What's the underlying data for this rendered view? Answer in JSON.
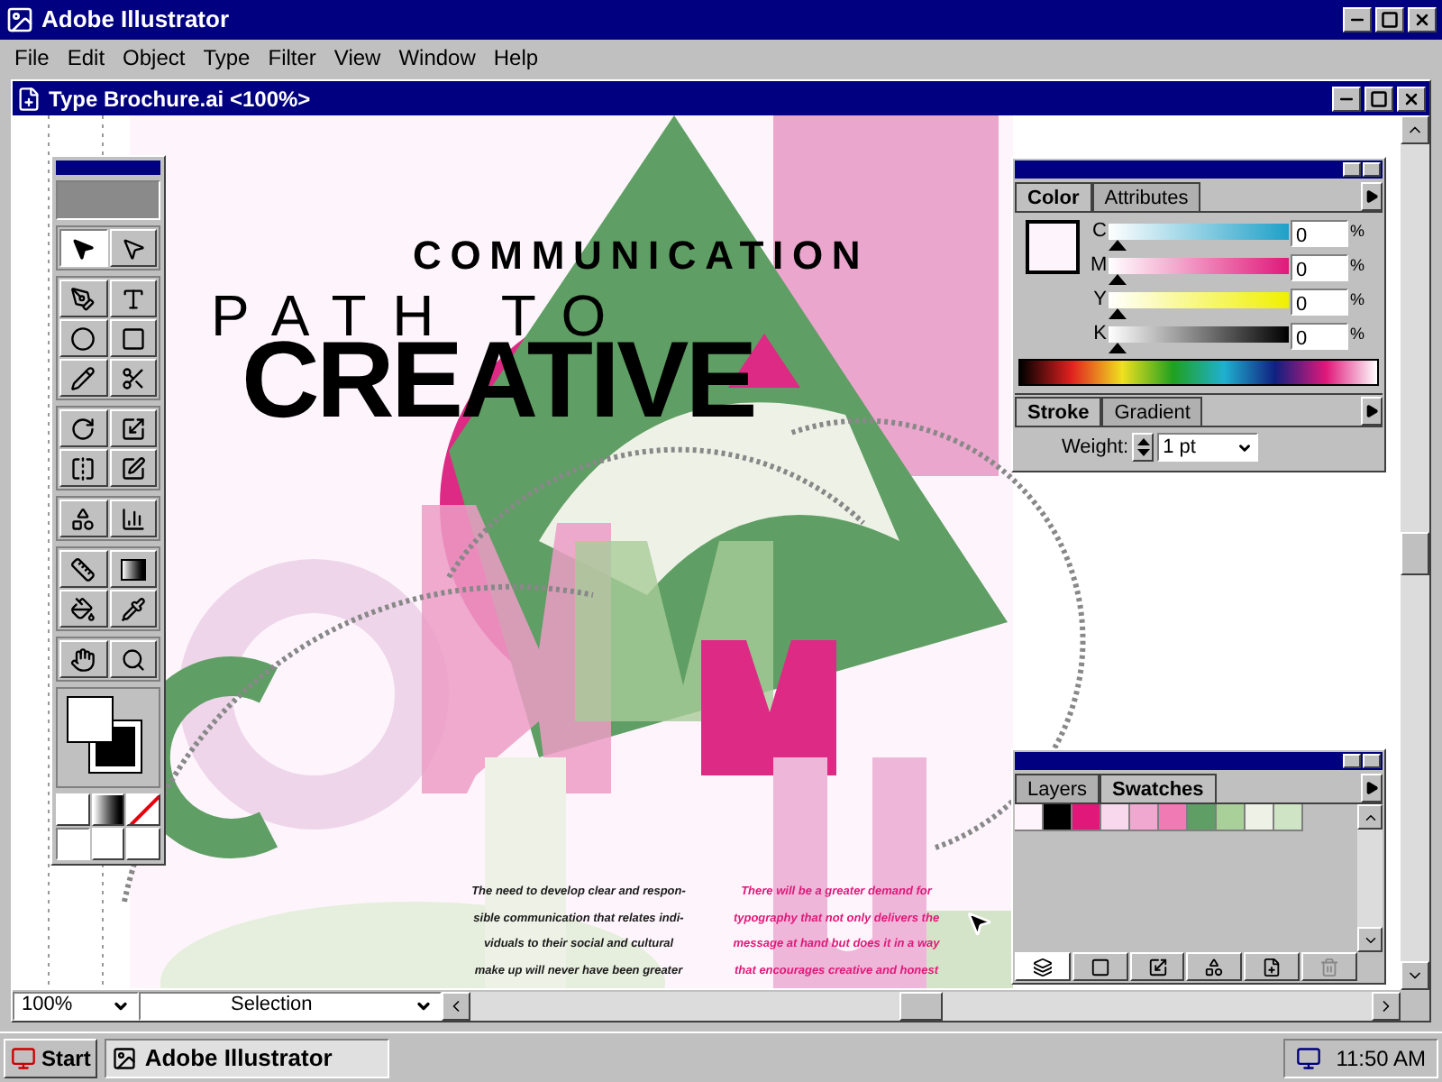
{
  "app": {
    "title": "Adobe Illustrator"
  },
  "menu": [
    "File",
    "Edit",
    "Object",
    "Type",
    "Filter",
    "View",
    "Window",
    "Help"
  ],
  "document": {
    "title": "Type Brochure.ai <100%>",
    "heading": "COMMUNICATION",
    "subheading": "PATH TO",
    "headline": "CREATIVE",
    "columns": [
      {
        "color": "#1a1a1a",
        "lines": [
          "The need to develop clear and respon-",
          "sible communication that relates indi-",
          "viduals to their social and cultural",
          "make up will never have been greater"
        ]
      },
      {
        "color": "#e0187a",
        "lines": [
          "There will be a greater demand for",
          "typography that not only delivers the",
          "message at hand but does it in a way",
          "that encourages creative and honest"
        ]
      }
    ],
    "zoom": "100%",
    "tool_status": "Selection"
  },
  "toolbox": {
    "groups": [
      [
        {
          "selected": true
        },
        {
          "selected": false
        }
      ],
      [
        {
          "selected": false
        },
        {
          "selected": false
        },
        {
          "selected": false
        },
        {
          "selected": false
        },
        {
          "selected": false
        },
        {
          "selected": false
        }
      ],
      [
        {
          "selected": false
        },
        {
          "selected": false
        },
        {
          "selected": false
        },
        {
          "selected": false
        }
      ],
      [
        {
          "selected": false
        },
        {
          "selected": false
        }
      ],
      [
        {
          "selected": false
        },
        {
          "selected": false
        },
        {
          "selected": false
        },
        {
          "selected": false
        }
      ],
      [
        {
          "selected": false
        },
        {
          "selected": false
        }
      ]
    ]
  },
  "color_panel": {
    "tabs": [
      {
        "label": "Color",
        "selected": true
      },
      {
        "label": "Attributes",
        "selected": false
      }
    ],
    "channels": [
      {
        "label": "C",
        "value": "0",
        "unit": "%",
        "level": 0
      },
      {
        "label": "M",
        "value": "0",
        "unit": "%",
        "level": 0
      },
      {
        "label": "Y",
        "value": "0",
        "unit": "%",
        "level": 0
      },
      {
        "label": "K",
        "value": "0",
        "unit": "%",
        "level": 0
      }
    ],
    "stroke_tabs": [
      {
        "label": "Stroke",
        "selected": true
      },
      {
        "label": "Gradient",
        "selected": false
      }
    ],
    "weight_label": "Weight:",
    "weight": "1 pt"
  },
  "swatches_panel": {
    "tabs": [
      {
        "label": "Layers",
        "selected": false
      },
      {
        "label": "Swatches",
        "selected": true
      }
    ],
    "swatches": [
      {
        "color": "#fdf5fb"
      },
      {
        "color": "#000000"
      },
      {
        "color": "#e0187a"
      },
      {
        "color": "#f8d8ec"
      },
      {
        "color": "#f0a8d0"
      },
      {
        "color": "#f07ab4"
      },
      {
        "color": "#5f9e64"
      },
      {
        "color": "#a8d098"
      },
      {
        "color": "#eef2e6"
      },
      {
        "color": "#cfe4c4"
      }
    ]
  },
  "taskbar": {
    "start": "Start",
    "tasks": [
      {
        "label": "Adobe Illustrator",
        "selected": true
      }
    ],
    "clock": "11:50 AM"
  }
}
